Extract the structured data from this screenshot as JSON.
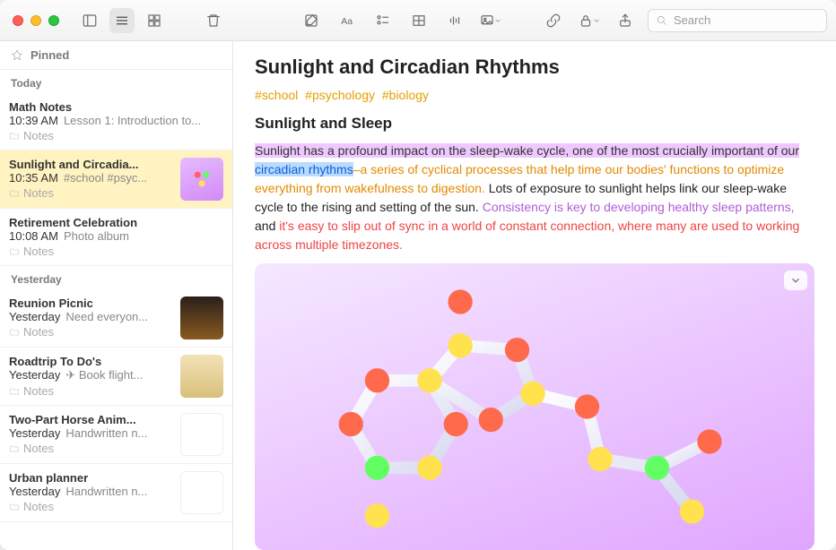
{
  "sidebar": {
    "pinned_label": "Pinned",
    "sections": [
      {
        "label": "Today"
      },
      {
        "label": "Yesterday"
      }
    ],
    "notes_today": [
      {
        "title": "Math Notes",
        "time": "10:39 AM",
        "preview": "Lesson 1: Introduction to...",
        "folder": "Notes",
        "thumb": ""
      },
      {
        "title": "Sunlight and Circadia...",
        "time": "10:35 AM",
        "preview": "#school #psyc...",
        "folder": "Notes",
        "thumb": "mole",
        "selected": true
      },
      {
        "title": "Retirement Celebration",
        "time": "10:08 AM",
        "preview": "Photo album",
        "folder": "Notes",
        "thumb": ""
      }
    ],
    "notes_yesterday": [
      {
        "title": "Reunion Picnic",
        "time": "Yesterday",
        "preview": "Need everyon...",
        "folder": "Notes",
        "thumb": "picnic"
      },
      {
        "title": "Roadtrip To Do's",
        "time": "Yesterday",
        "preview": "✈︎ Book flight...",
        "folder": "Notes",
        "thumb": "bike"
      },
      {
        "title": "Two-Part Horse Anim...",
        "time": "Yesterday",
        "preview": "Handwritten n...",
        "folder": "Notes",
        "thumb": "horse"
      },
      {
        "title": "Urban planner",
        "time": "Yesterday",
        "preview": "Handwritten n...",
        "folder": "Notes",
        "thumb": "urban"
      }
    ]
  },
  "note": {
    "title": "Sunlight and Circadian Rhythms",
    "tags": [
      "#school",
      "#psychology",
      "#biology"
    ],
    "heading": "Sunlight and Sleep",
    "seg1": "Sunlight has a profound impact on the sleep-wake cycle, one of the most crucially important of our ",
    "seg2": "circadian rhythms",
    "seg3": "–a series of cyclical processes that help time our bodies' functions to optimize everything from wakefulness to digestion.",
    "seg4": " Lots of exposure to sunlight helps link our sleep-wake cycle to the rising and setting of the sun. ",
    "seg5": "Consistency is key to developing healthy sleep patterns,",
    "seg6": " and ",
    "seg7": "it's easy to slip out of sync in a world of constant connection, where many are used to working across multiple timezones."
  },
  "search": {
    "placeholder": "Search"
  }
}
